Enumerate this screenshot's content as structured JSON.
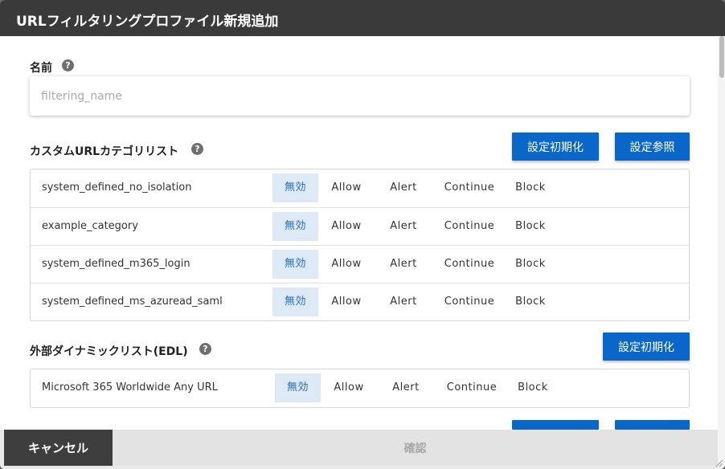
{
  "dialog": {
    "title": "URLフィルタリングプロファイル新規追加"
  },
  "name_section": {
    "label": "名前",
    "help": "?",
    "placeholder": "filtering_name",
    "value": ""
  },
  "custom_url_section": {
    "label": "カスタムURLカテゴリリスト",
    "help": "?",
    "reset_button": "設定初期化",
    "reference_button": "設定参照",
    "options": [
      "無効",
      "Allow",
      "Alert",
      "Continue",
      "Block"
    ],
    "selected_option": "無効",
    "rows": [
      {
        "name": "system_defined_no_isolation"
      },
      {
        "name": "example_category"
      },
      {
        "name": "system_defined_m365_login"
      },
      {
        "name": "system_defined_ms_azuread_saml"
      }
    ]
  },
  "edl_section": {
    "label": "外部ダイナミックリスト(EDL)",
    "help": "?",
    "reset_button": "設定初期化",
    "options": [
      "無効",
      "Allow",
      "Alert",
      "Continue",
      "Block"
    ],
    "selected_option": "無効",
    "rows": [
      {
        "name": "Microsoft 365 Worldwide Any URL"
      }
    ]
  },
  "footer": {
    "cancel": "キャンセル",
    "confirm": "確認"
  },
  "colors": {
    "title_bar": "#3a3a3a",
    "primary_button": "#0a67c9",
    "selected_option_bg": "#dde9f5",
    "selected_option_text": "#2a6fb8",
    "cancel_button": "#3e3e3e",
    "confirm_disabled": "#e3e3e3"
  }
}
